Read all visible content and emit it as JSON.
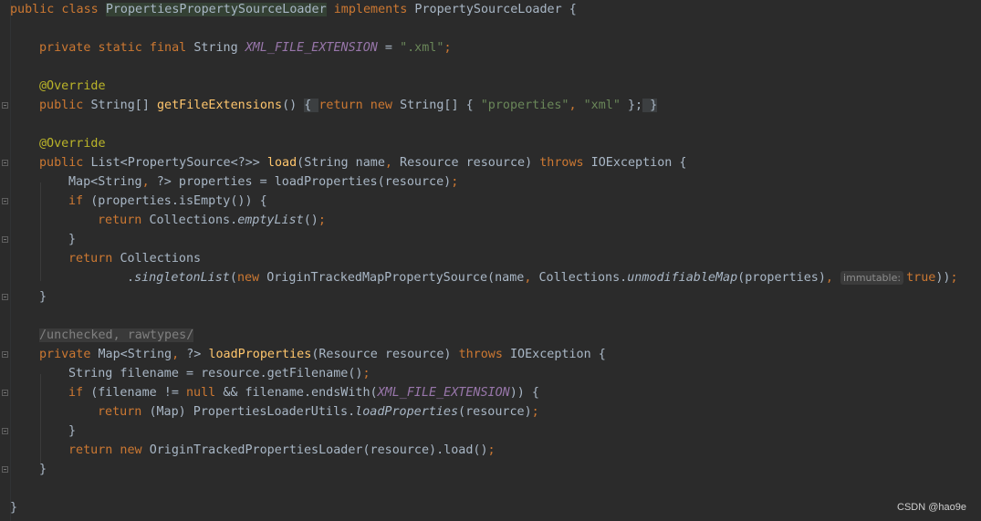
{
  "colors": {
    "background": "#2b2b2b",
    "keyword": "#cc7832",
    "identifier": "#a9b7c6",
    "method_declaration": "#ffc66d",
    "annotation": "#bbb529",
    "string": "#6a8759",
    "constant": "#9876aa",
    "comment": "#808080"
  },
  "editor": {
    "language": "Java",
    "lines": [
      {
        "indent": 0,
        "fold": false,
        "tokens": [
          {
            "t": "public class ",
            "k": "kw"
          },
          {
            "t": "PropertiesPropertySourceLoader",
            "k": "hlclass"
          },
          {
            "t": " ",
            "k": "plain"
          },
          {
            "t": "implements ",
            "k": "kw"
          },
          {
            "t": "PropertySourceLoader {",
            "k": "plain"
          }
        ]
      },
      {
        "indent": 0,
        "fold": false,
        "tokens": []
      },
      {
        "indent": 1,
        "fold": false,
        "tokens": [
          {
            "t": "private static final ",
            "k": "kw"
          },
          {
            "t": "String ",
            "k": "plain"
          },
          {
            "t": "XML_FILE_EXTENSION",
            "k": "const"
          },
          {
            "t": " = ",
            "k": "plain"
          },
          {
            "t": "\".xml\"",
            "k": "str"
          },
          {
            "t": ";",
            "k": "kw"
          }
        ]
      },
      {
        "indent": 0,
        "fold": false,
        "tokens": []
      },
      {
        "indent": 1,
        "fold": false,
        "tokens": [
          {
            "t": "@Override",
            "k": "anno"
          }
        ]
      },
      {
        "indent": 1,
        "fold": true,
        "tokens": [
          {
            "t": "public ",
            "k": "kw"
          },
          {
            "t": "String[] ",
            "k": "plain"
          },
          {
            "t": "getFileExtensions",
            "k": "method"
          },
          {
            "t": "() ",
            "k": "plain"
          },
          {
            "t": "{ ",
            "k": "foldbox"
          },
          {
            "t": "return new ",
            "k": "kw"
          },
          {
            "t": "String[] { ",
            "k": "plain"
          },
          {
            "t": "\"properties\"",
            "k": "str"
          },
          {
            "t": ", ",
            "k": "kw"
          },
          {
            "t": "\"xml\"",
            "k": "str"
          },
          {
            "t": " };",
            "k": "plain"
          },
          {
            "t": " }",
            "k": "foldbox"
          }
        ]
      },
      {
        "indent": 0,
        "fold": false,
        "tokens": []
      },
      {
        "indent": 1,
        "fold": false,
        "tokens": [
          {
            "t": "@Override",
            "k": "anno"
          }
        ]
      },
      {
        "indent": 1,
        "fold": true,
        "tokens": [
          {
            "t": "public ",
            "k": "kw"
          },
          {
            "t": "List<PropertySource<?>> ",
            "k": "plain"
          },
          {
            "t": "load",
            "k": "method"
          },
          {
            "t": "(String name",
            "k": "plain"
          },
          {
            "t": ", ",
            "k": "kw"
          },
          {
            "t": "Resource resource) ",
            "k": "plain"
          },
          {
            "t": "throws ",
            "k": "kw"
          },
          {
            "t": "IOException {",
            "k": "plain"
          }
        ]
      },
      {
        "indent": 2,
        "fold": false,
        "tokens": [
          {
            "t": "Map<String",
            "k": "plain"
          },
          {
            "t": ", ",
            "k": "kw"
          },
          {
            "t": "?> properties = loadProperties(resource)",
            "k": "plain"
          },
          {
            "t": ";",
            "k": "kw"
          }
        ]
      },
      {
        "indent": 2,
        "fold": true,
        "tokens": [
          {
            "t": "if ",
            "k": "kw"
          },
          {
            "t": "(properties.isEmpty()) {",
            "k": "plain"
          }
        ]
      },
      {
        "indent": 3,
        "fold": false,
        "tokens": [
          {
            "t": "return ",
            "k": "kw"
          },
          {
            "t": "Collections.",
            "k": "plain"
          },
          {
            "t": "emptyList",
            "k": "static"
          },
          {
            "t": "()",
            "k": "plain"
          },
          {
            "t": ";",
            "k": "kw"
          }
        ]
      },
      {
        "indent": 2,
        "fold": true,
        "tokens": [
          {
            "t": "}",
            "k": "plain"
          }
        ]
      },
      {
        "indent": 2,
        "fold": false,
        "tokens": [
          {
            "t": "return ",
            "k": "kw"
          },
          {
            "t": "Collections",
            "k": "plain"
          }
        ]
      },
      {
        "indent": 4,
        "fold": false,
        "tokens": [
          {
            "t": ".",
            "k": "plain"
          },
          {
            "t": "singletonList",
            "k": "static"
          },
          {
            "t": "(",
            "k": "plain"
          },
          {
            "t": "new ",
            "k": "kw"
          },
          {
            "t": "OriginTrackedMapPropertySource(name",
            "k": "plain"
          },
          {
            "t": ", ",
            "k": "kw"
          },
          {
            "t": "Collections.",
            "k": "plain"
          },
          {
            "t": "unmodifiableMap",
            "k": "static"
          },
          {
            "t": "(properties)",
            "k": "plain"
          },
          {
            "t": ", ",
            "k": "kw"
          },
          {
            "t": "immutable:",
            "k": "hint"
          },
          {
            "t": "true",
            "k": "kw"
          },
          {
            "t": "))",
            "k": "plain"
          },
          {
            "t": ";",
            "k": "kw"
          }
        ]
      },
      {
        "indent": 1,
        "fold": true,
        "tokens": [
          {
            "t": "}",
            "k": "plain"
          }
        ]
      },
      {
        "indent": 0,
        "fold": false,
        "tokens": []
      },
      {
        "indent": 1,
        "fold": false,
        "tokens": [
          {
            "t": "/unchecked, rawtypes/",
            "k": "comment"
          }
        ]
      },
      {
        "indent": 1,
        "fold": true,
        "tokens": [
          {
            "t": "private ",
            "k": "kw"
          },
          {
            "t": "Map<String",
            "k": "plain"
          },
          {
            "t": ", ",
            "k": "kw"
          },
          {
            "t": "?> ",
            "k": "plain"
          },
          {
            "t": "loadProperties",
            "k": "method"
          },
          {
            "t": "(Resource resource) ",
            "k": "plain"
          },
          {
            "t": "throws ",
            "k": "kw"
          },
          {
            "t": "IOException {",
            "k": "plain"
          }
        ]
      },
      {
        "indent": 2,
        "fold": false,
        "tokens": [
          {
            "t": "String filename = resource.getFilename()",
            "k": "plain"
          },
          {
            "t": ";",
            "k": "kw"
          }
        ]
      },
      {
        "indent": 2,
        "fold": true,
        "tokens": [
          {
            "t": "if ",
            "k": "kw"
          },
          {
            "t": "(filename != ",
            "k": "plain"
          },
          {
            "t": "null ",
            "k": "kw"
          },
          {
            "t": "&& filename.endsWith(",
            "k": "plain"
          },
          {
            "t": "XML_FILE_EXTENSION",
            "k": "const"
          },
          {
            "t": ")) {",
            "k": "plain"
          }
        ]
      },
      {
        "indent": 3,
        "fold": false,
        "tokens": [
          {
            "t": "return ",
            "k": "kw"
          },
          {
            "t": "(Map) PropertiesLoaderUtils.",
            "k": "plain"
          },
          {
            "t": "loadProperties",
            "k": "static"
          },
          {
            "t": "(resource)",
            "k": "plain"
          },
          {
            "t": ";",
            "k": "kw"
          }
        ]
      },
      {
        "indent": 2,
        "fold": true,
        "tokens": [
          {
            "t": "}",
            "k": "plain"
          }
        ]
      },
      {
        "indent": 2,
        "fold": false,
        "tokens": [
          {
            "t": "return new ",
            "k": "kw"
          },
          {
            "t": "OriginTrackedPropertiesLoader(resource).load()",
            "k": "plain"
          },
          {
            "t": ";",
            "k": "kw"
          }
        ]
      },
      {
        "indent": 1,
        "fold": true,
        "tokens": [
          {
            "t": "}",
            "k": "plain"
          }
        ]
      },
      {
        "indent": 0,
        "fold": false,
        "tokens": []
      },
      {
        "indent": 0,
        "fold": false,
        "tokens": [
          {
            "t": "}",
            "k": "plain"
          }
        ]
      }
    ]
  },
  "watermark": "CSDN @hao9e"
}
